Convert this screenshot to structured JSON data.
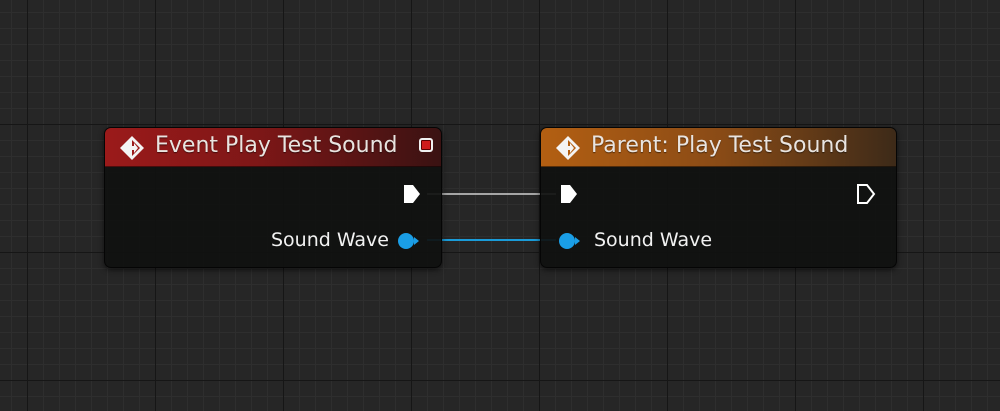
{
  "nodes": {
    "event": {
      "title": "Event Play Test Sound",
      "header_color": "#9b1a1a",
      "icon": "event-diamond-icon",
      "corner_icon": "stop-icon",
      "pins": {
        "exec_out": "",
        "sound_wave_label": "Sound Wave"
      }
    },
    "parent": {
      "title": "Parent: Play Test Sound",
      "header_color": "#b35f12",
      "icon": "function-diamond-icon",
      "pins": {
        "exec_in": "",
        "exec_out": "",
        "sound_wave_label": "Sound Wave"
      }
    }
  },
  "wires": {
    "exec_color": "#d8d8d8",
    "data_color": "#1a9bd8"
  },
  "colors": {
    "canvas_bg": "#262626",
    "pin_object": "#1a9ee6",
    "pin_exec": "#ffffff"
  }
}
